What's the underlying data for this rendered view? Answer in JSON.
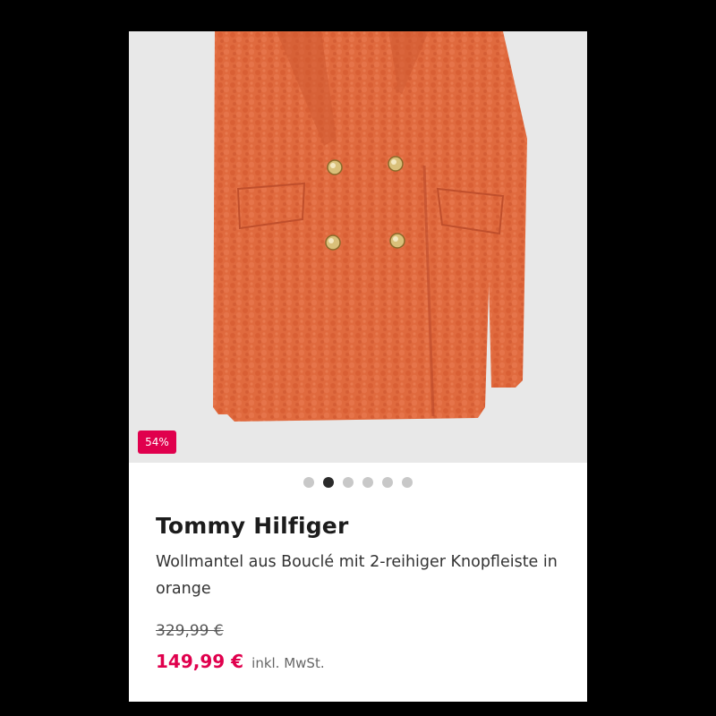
{
  "product": {
    "discount_badge": "54%",
    "brand": "Tommy Hilfiger",
    "name": "Wollmantel aus Bouclé mit 2-reihiger Knopfleiste in orange",
    "old_price": "329,99 €",
    "new_price": "149,99 €",
    "vat_note": "inkl. MwSt."
  },
  "gallery": {
    "image_count": 6,
    "active_index": 1,
    "image_subject": "orange boucle wool coat",
    "background_color": "#e8e8e8",
    "coat_color": "#e06a3e"
  },
  "colors": {
    "accent": "#e0004d",
    "brand_text": "#1c1c1c",
    "dot_active": "#2a2a2a",
    "dot_inactive": "#c8c8c8"
  }
}
